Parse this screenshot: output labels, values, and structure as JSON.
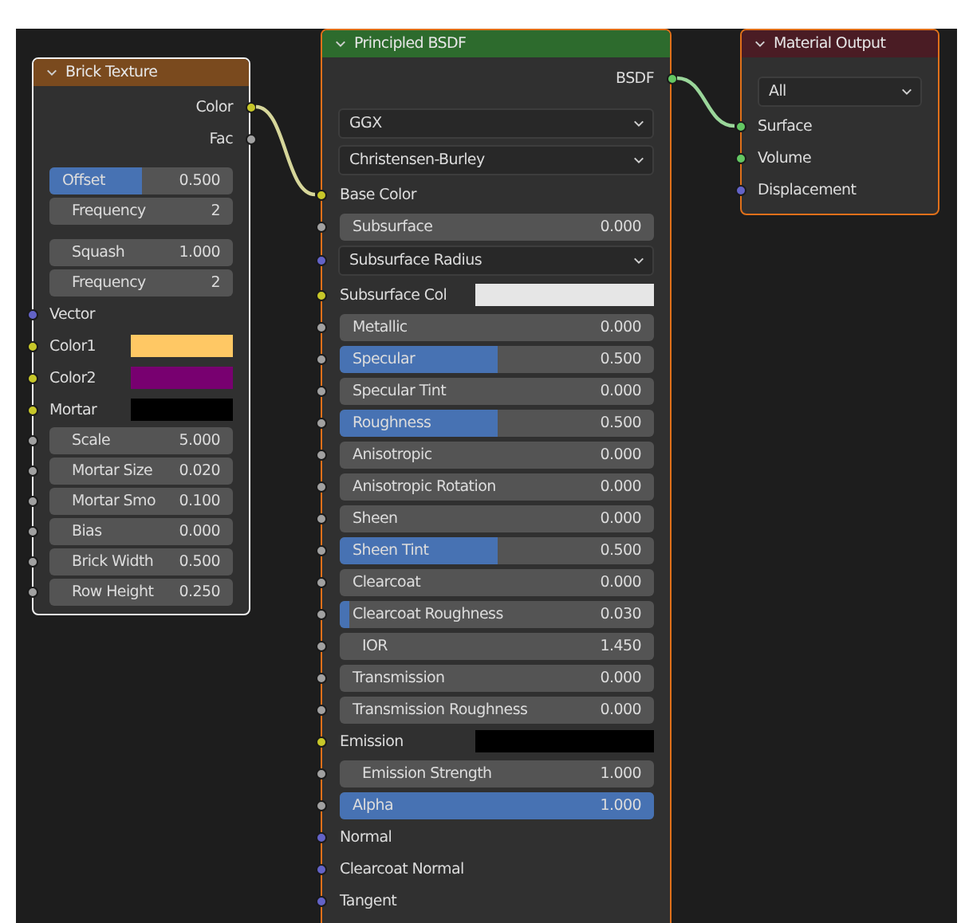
{
  "nodes": [
    {
      "title": "Brick Texture",
      "color": "#7a4a1e",
      "selected": true,
      "active": true,
      "rows": [
        {
          "kind": "output",
          "label": "Color",
          "socket": {
            "color": "#c7c729"
          },
          "linked": true
        },
        {
          "kind": "output",
          "label": "Fac",
          "socket": {
            "color": "#a1a1a1"
          }
        },
        {
          "kind": "slider",
          "label": "Offset",
          "value": "0.500",
          "level": 0.5,
          "gap": true
        },
        {
          "kind": "number",
          "label": "Frequency",
          "value": "2"
        },
        {
          "kind": "number",
          "label": "Squash",
          "value": "1.000",
          "gap": true
        },
        {
          "kind": "number",
          "label": "Frequency",
          "value": "2"
        },
        {
          "kind": "input",
          "label": "Vector",
          "socket": {
            "color": "#6363c7"
          }
        },
        {
          "kind": "color",
          "label": "Color1",
          "socket": {
            "color": "#c7c729"
          },
          "swatch": {
            "color": "#ffc864"
          }
        },
        {
          "kind": "color",
          "label": "Color2",
          "socket": {
            "color": "#c7c729"
          },
          "swatch": {
            "color": "#780070"
          }
        },
        {
          "kind": "color",
          "label": "Mortar",
          "socket": {
            "color": "#c7c729"
          },
          "swatch": {
            "color": "#000000"
          }
        },
        {
          "kind": "number",
          "label": "Scale",
          "value": "5.000",
          "socket": {
            "color": "#a1a1a1"
          }
        },
        {
          "kind": "number",
          "label": "Mortar Size",
          "value": "0.020",
          "socket": {
            "color": "#a1a1a1"
          }
        },
        {
          "kind": "number",
          "label": "Mortar Smo",
          "value": "0.100",
          "socket": {
            "color": "#a1a1a1"
          }
        },
        {
          "kind": "number",
          "label": "Bias",
          "value": "0.000",
          "socket": {
            "color": "#a1a1a1"
          }
        },
        {
          "kind": "number",
          "label": "Brick Width",
          "value": "0.500",
          "socket": {
            "color": "#a1a1a1"
          }
        },
        {
          "kind": "number",
          "label": "Row Height",
          "value": "0.250",
          "socket": {
            "color": "#a1a1a1"
          }
        }
      ]
    },
    {
      "title": "Principled BSDF",
      "color": "#2d6b2d",
      "selected": true,
      "active": false,
      "rows": [
        {
          "kind": "output",
          "label": "BSDF",
          "socket": {
            "color": "#63c763"
          },
          "linked": true
        },
        {
          "kind": "dropdown",
          "value": "GGX",
          "gap": true
        },
        {
          "kind": "dropdown",
          "value": "Christensen-Burley"
        },
        {
          "kind": "input",
          "label": "Base Color",
          "socket": {
            "color": "#c7c729"
          },
          "link": {
            "color": "#d6d69a"
          }
        },
        {
          "kind": "slider",
          "label": "Subsurface",
          "value": "0.000",
          "level": 0,
          "socket": {
            "color": "#a1a1a1"
          }
        },
        {
          "kind": "dropdown",
          "value": "Subsurface Radius",
          "socket": {
            "color": "#6363c7"
          }
        },
        {
          "kind": "color",
          "label": "Subsurface Col",
          "socket": {
            "color": "#c7c729"
          },
          "swatch": {
            "color": "#e6e6e6"
          }
        },
        {
          "kind": "slider",
          "label": "Metallic",
          "value": "0.000",
          "level": 0,
          "socket": {
            "color": "#a1a1a1"
          }
        },
        {
          "kind": "slider",
          "label": "Specular",
          "value": "0.500",
          "level": 0.5,
          "socket": {
            "color": "#a1a1a1"
          }
        },
        {
          "kind": "slider",
          "label": "Specular Tint",
          "value": "0.000",
          "level": 0,
          "socket": {
            "color": "#a1a1a1"
          }
        },
        {
          "kind": "slider",
          "label": "Roughness",
          "value": "0.500",
          "level": 0.5,
          "socket": {
            "color": "#a1a1a1"
          }
        },
        {
          "kind": "slider",
          "label": "Anisotropic",
          "value": "0.000",
          "level": 0,
          "socket": {
            "color": "#a1a1a1"
          }
        },
        {
          "kind": "slider",
          "label": "Anisotropic Rotation",
          "value": "0.000",
          "level": 0,
          "socket": {
            "color": "#a1a1a1"
          }
        },
        {
          "kind": "slider",
          "label": "Sheen",
          "value": "0.000",
          "level": 0,
          "socket": {
            "color": "#a1a1a1"
          }
        },
        {
          "kind": "slider",
          "label": "Sheen Tint",
          "value": "0.500",
          "level": 0.5,
          "socket": {
            "color": "#a1a1a1"
          }
        },
        {
          "kind": "slider",
          "label": "Clearcoat",
          "value": "0.000",
          "level": 0,
          "socket": {
            "color": "#a1a1a1"
          }
        },
        {
          "kind": "slider",
          "label": "Clearcoat Roughness",
          "value": "0.030",
          "level": 0.03,
          "socket": {
            "color": "#a1a1a1"
          }
        },
        {
          "kind": "number",
          "label": "IOR",
          "value": "1.450",
          "socket": {
            "color": "#a1a1a1"
          }
        },
        {
          "kind": "slider",
          "label": "Transmission",
          "value": "0.000",
          "level": 0,
          "socket": {
            "color": "#a1a1a1"
          }
        },
        {
          "kind": "slider",
          "label": "Transmission Roughness",
          "value": "0.000",
          "level": 0,
          "socket": {
            "color": "#a1a1a1"
          }
        },
        {
          "kind": "color",
          "label": "Emission",
          "socket": {
            "color": "#c7c729"
          },
          "swatch": {
            "color": "#000000"
          }
        },
        {
          "kind": "number",
          "label": "Emission Strength",
          "value": "1.000",
          "socket": {
            "color": "#a1a1a1"
          }
        },
        {
          "kind": "slider",
          "label": "Alpha",
          "value": "1.000",
          "level": 1,
          "socket": {
            "color": "#a1a1a1"
          }
        },
        {
          "kind": "input",
          "label": "Normal",
          "socket": {
            "color": "#6363c7"
          }
        },
        {
          "kind": "input",
          "label": "Clearcoat Normal",
          "socket": {
            "color": "#6363c7"
          }
        },
        {
          "kind": "input",
          "label": "Tangent",
          "socket": {
            "color": "#6363c7"
          }
        }
      ]
    },
    {
      "title": "Material Output",
      "color": "#4a1c24",
      "selected": true,
      "active": false,
      "rows": [
        {
          "kind": "dropdown",
          "value": "All",
          "gap": true
        },
        {
          "kind": "input",
          "label": "Surface",
          "socket": {
            "color": "#63c763"
          },
          "link": {
            "color": "#9ad69a"
          }
        },
        {
          "kind": "input",
          "label": "Volume",
          "socket": {
            "color": "#63c763"
          }
        },
        {
          "kind": "input",
          "label": "Displacement",
          "socket": {
            "color": "#6363c7"
          }
        }
      ]
    }
  ]
}
